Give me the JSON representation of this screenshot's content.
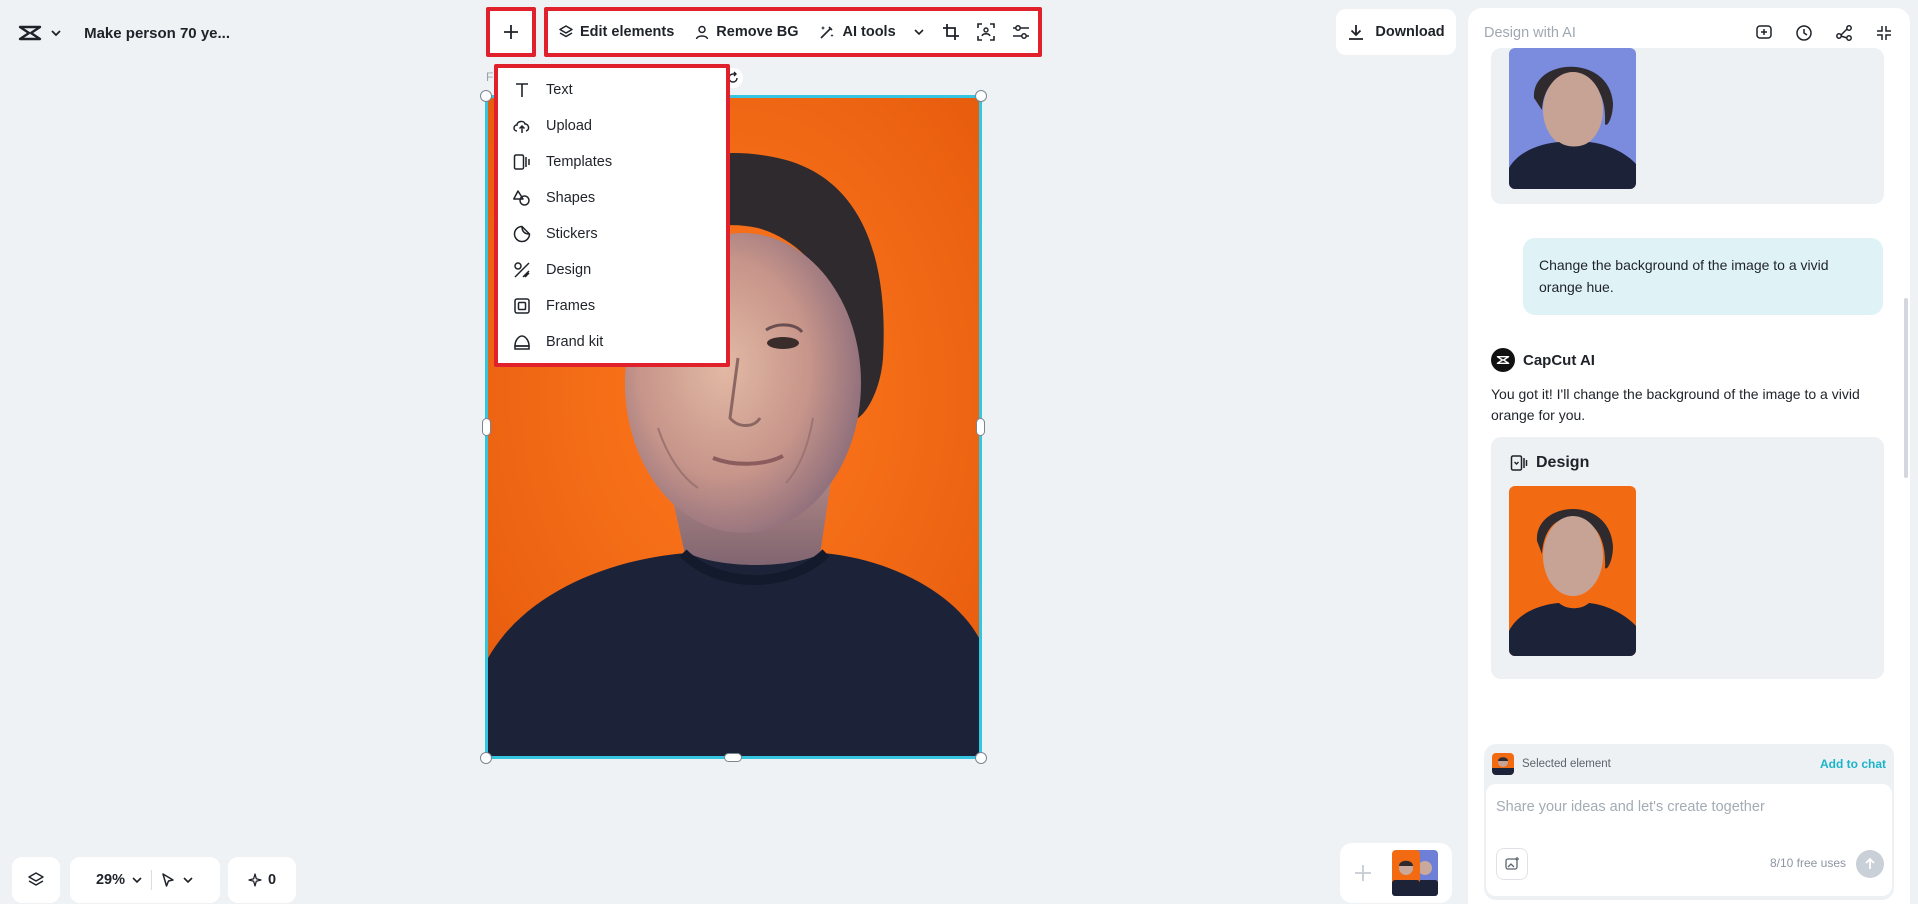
{
  "header": {
    "project_title": "Make person 70 ye...",
    "logo_icon": "capcut-logo-icon"
  },
  "toolbar": {
    "add_icon": "plus-icon",
    "edit_elements_label": "Edit elements",
    "remove_bg_label": "Remove BG",
    "ai_tools_label": "AI tools",
    "crop_icon": "crop-icon",
    "scan_icon": "scan-icon",
    "adjust_icon": "sliders-icon",
    "highlight_color": "#e0202a"
  },
  "download": {
    "label": "Download"
  },
  "insert_menu": {
    "items": [
      {
        "label": "Text",
        "icon": "text-icon"
      },
      {
        "label": "Upload",
        "icon": "cloud-upload-icon"
      },
      {
        "label": "Templates",
        "icon": "templates-icon"
      },
      {
        "label": "Shapes",
        "icon": "shapes-icon"
      },
      {
        "label": "Stickers",
        "icon": "sticker-icon"
      },
      {
        "label": "Design",
        "icon": "design-icon"
      },
      {
        "label": "Frames",
        "icon": "frame-icon"
      },
      {
        "label": "Brand kit",
        "icon": "brand-kit-icon"
      }
    ]
  },
  "canvas": {
    "selection_color": "#34c6e0",
    "background_color": "#f26b12"
  },
  "bottom_controls": {
    "zoom_label": "29%",
    "credits_count": "0"
  },
  "ai_panel": {
    "title": "Design with AI",
    "user_message": "Change the background of the image to a vivid orange hue.",
    "assistant_name": "CapCut AI",
    "assistant_message": "You got it! I'll change the background of the image to a vivid orange for you.",
    "design_card_title": "Design",
    "selected_element_label": "Selected element",
    "add_to_chat_label": "Add to chat",
    "input_placeholder": "Share your ideas and let's create together",
    "free_uses": "8/10 free uses",
    "accent_color": "#1bb4c9"
  }
}
